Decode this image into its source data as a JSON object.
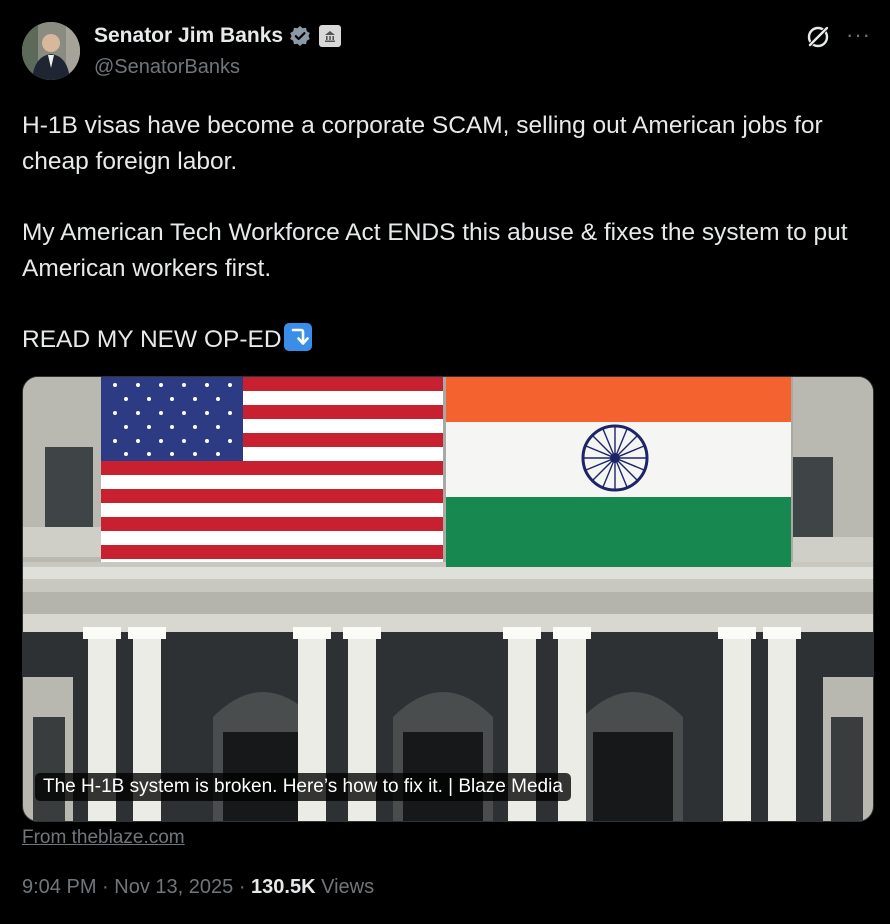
{
  "author": {
    "name": "Senator Jim Banks",
    "handle": "@SenatorBanks"
  },
  "post": {
    "paragraph1": "H-1B visas have become a corporate SCAM, selling out American jobs for cheap foreign labor.",
    "paragraph2": "My American Tech Workforce Act ENDS this abuse & fixes the system to put American workers first.",
    "paragraph3": "READ MY NEW OP-ED",
    "emoji": "⤵"
  },
  "link_card": {
    "caption": "The H-1B system is broken. Here’s how to fix it. | Blaze Media",
    "source": "From theblaze.com"
  },
  "meta": {
    "time": "9:04 PM",
    "date": "Nov 13, 2025",
    "views_count": "130.5K",
    "views_label": "Views"
  },
  "icons": [
    "verified-badge-icon",
    "government-building-icon",
    "grok-icon",
    "more-icon"
  ],
  "colors": {
    "background": "#000000",
    "text": "#e7e9ea",
    "muted": "#71767b",
    "verified": "#1d9bf0"
  }
}
